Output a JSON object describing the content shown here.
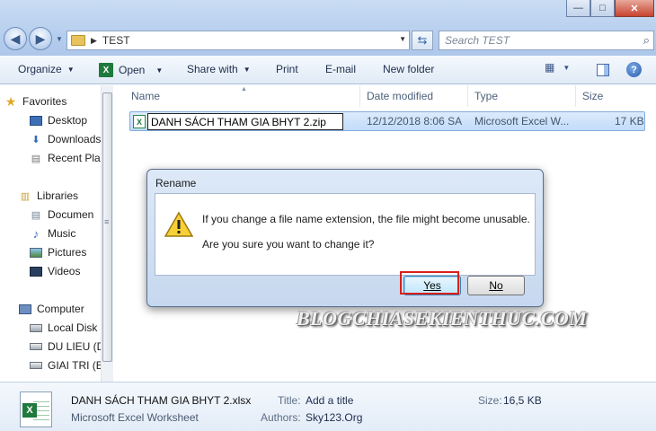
{
  "window": {
    "controls": {
      "minimize": "—",
      "maximize": "□",
      "close": "✕"
    }
  },
  "address": {
    "path": "TEST",
    "search_placeholder": "Search TEST"
  },
  "toolbar": {
    "organize": "Organize",
    "open": "Open",
    "share_with": "Share with",
    "print": "Print",
    "email": "E-mail",
    "new_folder": "New folder"
  },
  "nav": {
    "favorites": "Favorites",
    "desktop": "Desktop",
    "downloads": "Downloads",
    "recent": "Recent Plac",
    "libraries": "Libraries",
    "documents": "Documen",
    "music": "Music",
    "pictures": "Pictures",
    "videos": "Videos",
    "computer": "Computer",
    "local_disk": "Local Disk",
    "du_lieu": "DU LIEU (D",
    "giai_tri": "GIAI TRI (E:"
  },
  "columns": {
    "name": "Name",
    "date_modified": "Date modified",
    "type": "Type",
    "size": "Size"
  },
  "file": {
    "rename_value": "DANH SÁCH THAM GIA BHYT 2.zip",
    "date": "12/12/2018 8:06 SA",
    "type": "Microsoft Excel W...",
    "size": "17 KB"
  },
  "dialog": {
    "title": "Rename",
    "message1": "If you change a file name extension, the file might become unusable.",
    "message2": "Are you sure you want to change it?",
    "yes": "Yes",
    "no": "No"
  },
  "watermark": "BLOGCHIASEKIENTHUC.COM",
  "details": {
    "filename": "DANH SÁCH THAM GIA BHYT 2.xlsx",
    "filetype": "Microsoft Excel Worksheet",
    "title_label": "Title:",
    "title_value": "Add a title",
    "authors_label": "Authors:",
    "authors_value": "Sky123.Org",
    "size_label": "Size:",
    "size_value": "16,5 KB"
  },
  "colors": {
    "selection": "#c1dcfa",
    "highlight_box": "#d9201c",
    "excel_green": "#1f7a3d"
  }
}
